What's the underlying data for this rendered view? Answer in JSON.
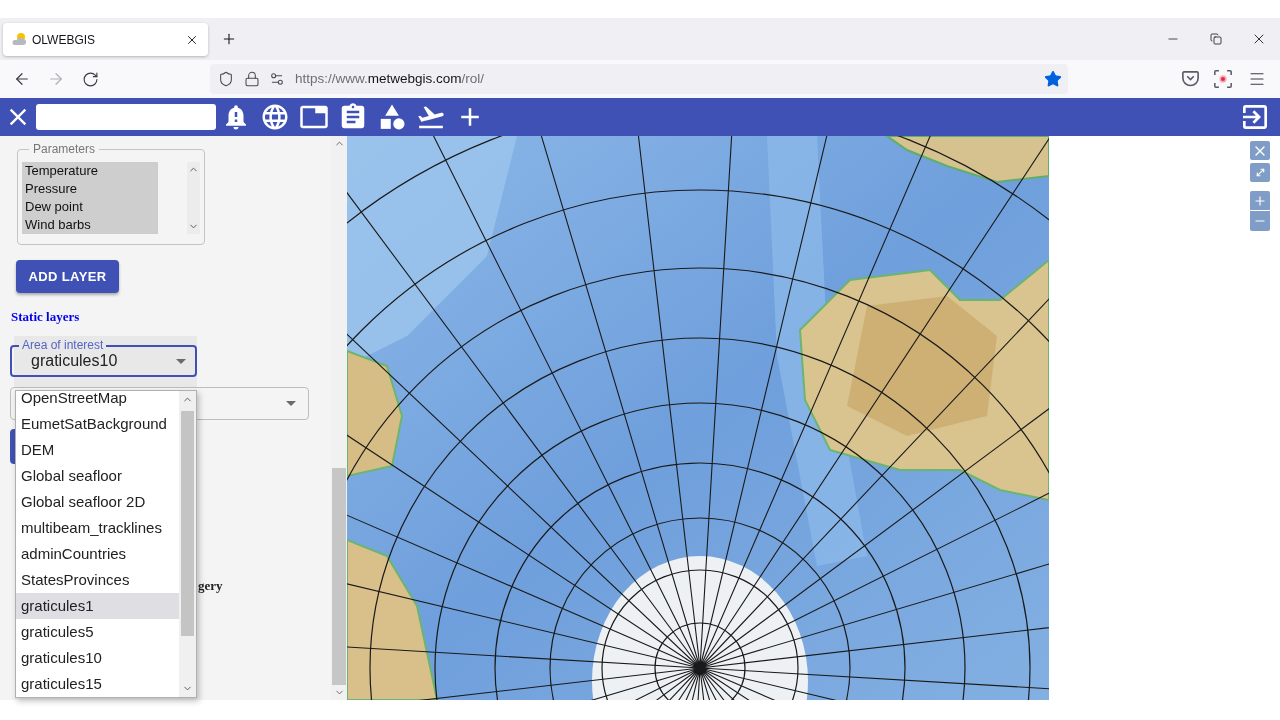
{
  "browser": {
    "tab": {
      "title": "OLWEBGIS"
    },
    "forward_disabled": true,
    "address": {
      "prefix": "https://www.",
      "domain": "metwebgis.com",
      "path": "/rol/"
    },
    "bookmarked": true
  },
  "sidebar": {
    "parameters": {
      "legend": "Parameters",
      "options": [
        {
          "label": "Temperature",
          "selected": true
        },
        {
          "label": "Pressure",
          "selected": true
        },
        {
          "label": "Dew point",
          "selected": true
        },
        {
          "label": "Wind barbs",
          "selected": true
        }
      ]
    },
    "add_layer_button": "ADD LAYER",
    "static_layers_heading": "Static layers",
    "area_of_interest": {
      "label": "Area of interest",
      "value": "graticules10",
      "focused": true
    },
    "style_select": {
      "expanded": true,
      "options": [
        {
          "label": "OpenStreetMap",
          "selected": false
        },
        {
          "label": "EumetSatBackground",
          "selected": false
        },
        {
          "label": "DEM",
          "selected": false
        },
        {
          "label": "Global seafloor",
          "selected": false
        },
        {
          "label": "Global seafloor 2D",
          "selected": false
        },
        {
          "label": "multibeam_tracklines",
          "selected": false
        },
        {
          "label": "adminCountries",
          "selected": false
        },
        {
          "label": "StatesProvinces",
          "selected": false
        },
        {
          "label": "graticules1",
          "selected": true
        },
        {
          "label": "graticules5",
          "selected": false
        },
        {
          "label": "graticules10",
          "selected": false
        },
        {
          "label": "graticules15",
          "selected": false
        }
      ]
    },
    "partly_covered_text": "gery"
  }
}
